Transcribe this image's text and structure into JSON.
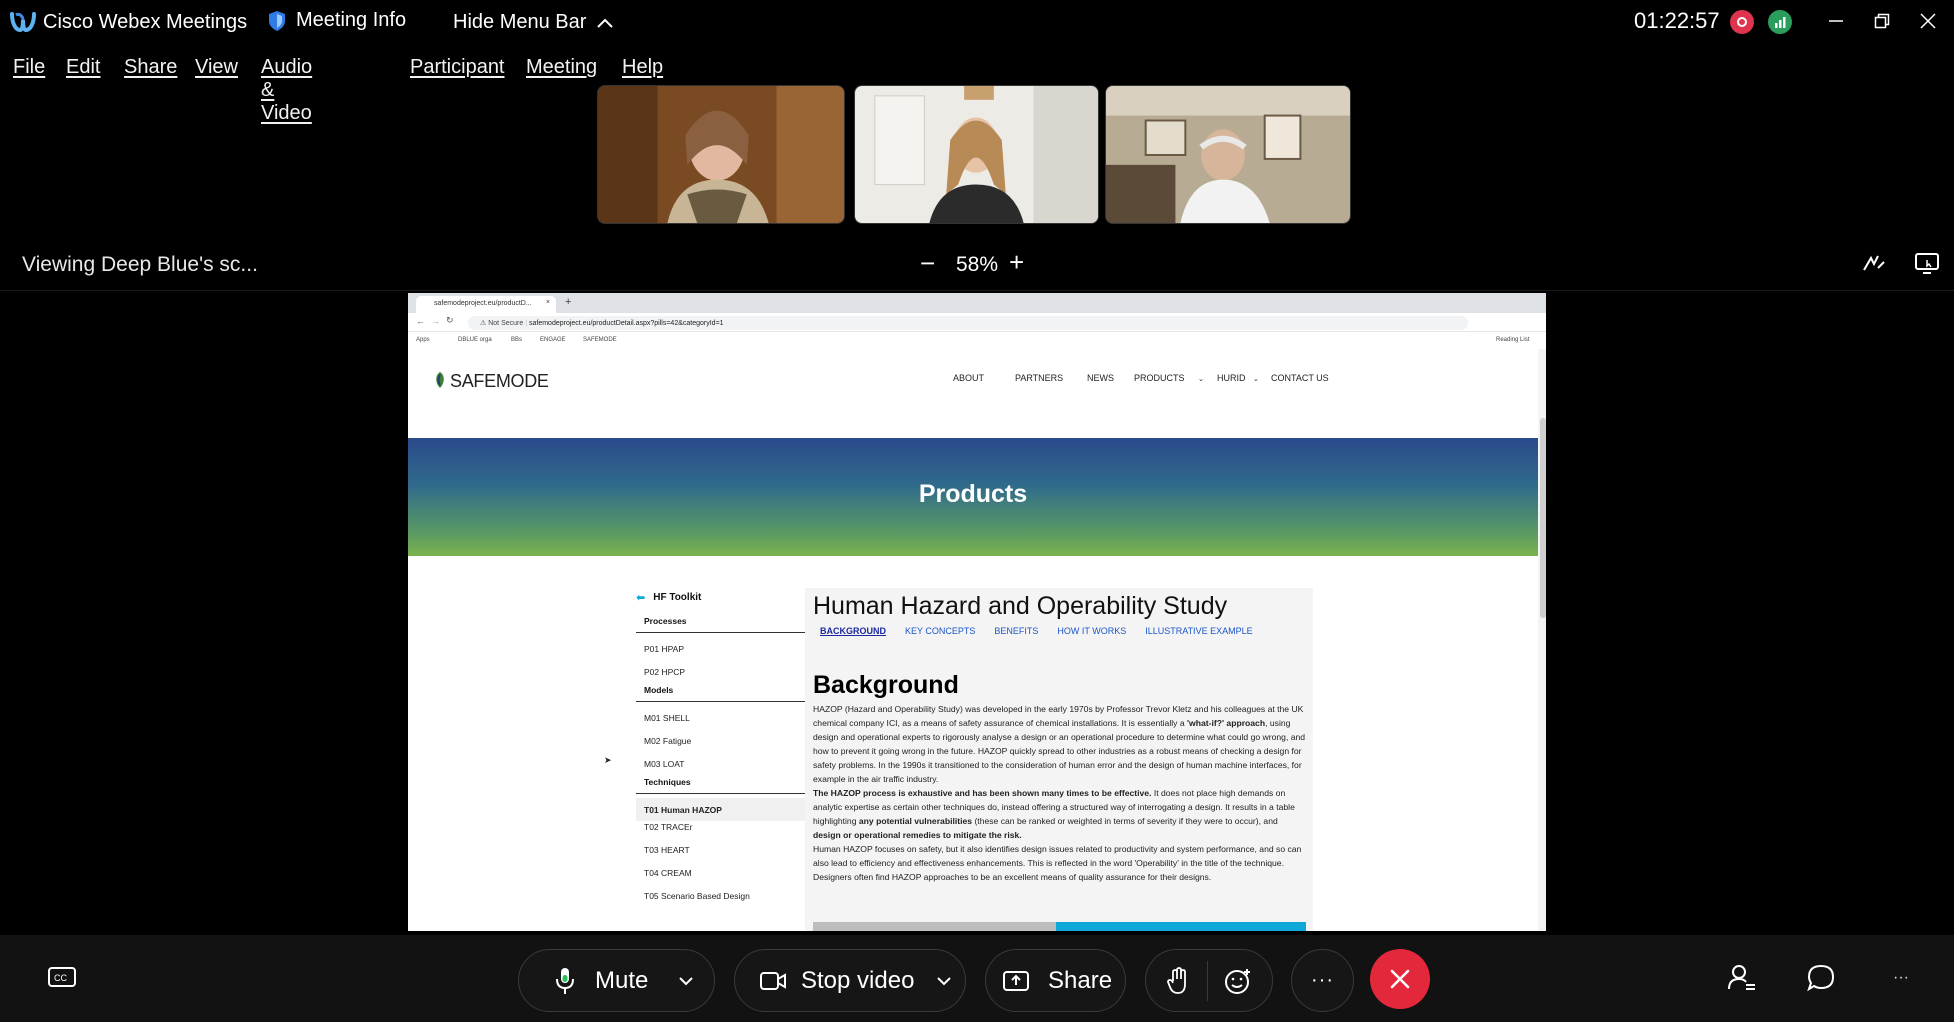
{
  "app": {
    "title": "Cisco Webex Meetings",
    "meeting_info": "Meeting Info",
    "hide_menu": "Hide Menu Bar",
    "timer": "01:22:57"
  },
  "menu": [
    "File",
    "Edit",
    "Share",
    "View",
    "Audio & Video",
    "Participant",
    "Meeting",
    "Help"
  ],
  "share_bar": {
    "viewing": "Viewing Deep Blue's sc...",
    "zoom": "58%",
    "zoom_minus": "−",
    "zoom_plus": "+"
  },
  "browser": {
    "tab_title": "safemodeproject.eu/productD...",
    "url_prefix": "Not Secure",
    "url": "safemodeproject.eu/productDetail.aspx?pills=42&categoryId=1",
    "bookmarks": [
      "Apps",
      "DBLUE orga",
      "BBs",
      "ENGAGE",
      "SAFEMODE"
    ],
    "reading_list": "Reading List"
  },
  "site": {
    "logo": "SAFEMODE",
    "nav": [
      "ABOUT",
      "PARTNERS",
      "NEWS",
      "PRODUCTS",
      "HURID",
      "CONTACT US"
    ],
    "hero_title": "Products",
    "toolkit": {
      "title": "HF Toolkit",
      "processes_label": "Processes",
      "processes": [
        "P01 HPAP",
        "P02 HPCP"
      ],
      "models_label": "Models",
      "models": [
        "M01 SHELL",
        "M02 Fatigue",
        "M03 LOAT"
      ],
      "techniques_label": "Techniques",
      "techniques": [
        "T01 Human HAZOP",
        "T02 TRACEr",
        "T03 HEART",
        "T04 CREAM",
        "T05 Scenario Based Design"
      ]
    },
    "content": {
      "title": "Human Hazard and Operability Study",
      "tabs": [
        "BACKGROUND",
        "KEY CONCEPTS",
        "BENEFITS",
        "HOW IT WORKS",
        "ILLUSTRATIVE EXAMPLE"
      ],
      "heading": "Background",
      "para1_a": "HAZOP (Hazard and Operability Study) was developed in the early 1970s by Professor Trevor Kletz and his colleagues at the UK chemical company ICI, as a means of safety assurance of chemical installations. It is essentially a ",
      "para1_b": "'what-if?' approach",
      "para1_c": ", using design and operational experts to rigorously analyse a design or an operational procedure to determine what could go wrong, and how to prevent it going wrong in the future. HAZOP quickly spread to other industries as a robust means of checking a design for safety problems. In the 1990s it transitioned to the consideration of human error and the design of human machine interfaces, for example in the air traffic industry.",
      "para2_a": "The HAZOP process is exhaustive and has been shown many times to be effective.",
      "para2_b": " It does not place high demands on analytic expertise as certain other techniques do, instead offering a structured way of interrogating a design. It results in a table highlighting ",
      "para2_c": "any potential vulnerabilities",
      "para2_d": " (these can be ranked or weighted in terms of severity if they were to occur), and ",
      "para2_e": "design or operational remedies to mitigate the risk.",
      "para3": "Human HAZOP focuses on safety, but it also identifies design issues related to productivity and system performance, and so can also lead to efficiency and effectiveness enhancements. This is reflected in the word 'Operability' in the title of the technique. Designers often find HAZOP approaches to be an excellent means of quality assurance for their designs."
    }
  },
  "controls": {
    "mute": "Mute",
    "stop_video": "Stop video",
    "share": "Share",
    "more": "···"
  },
  "colors": {
    "end_call": "#e4283c",
    "recording": "#e0334d",
    "network": "#2a9d5c"
  }
}
